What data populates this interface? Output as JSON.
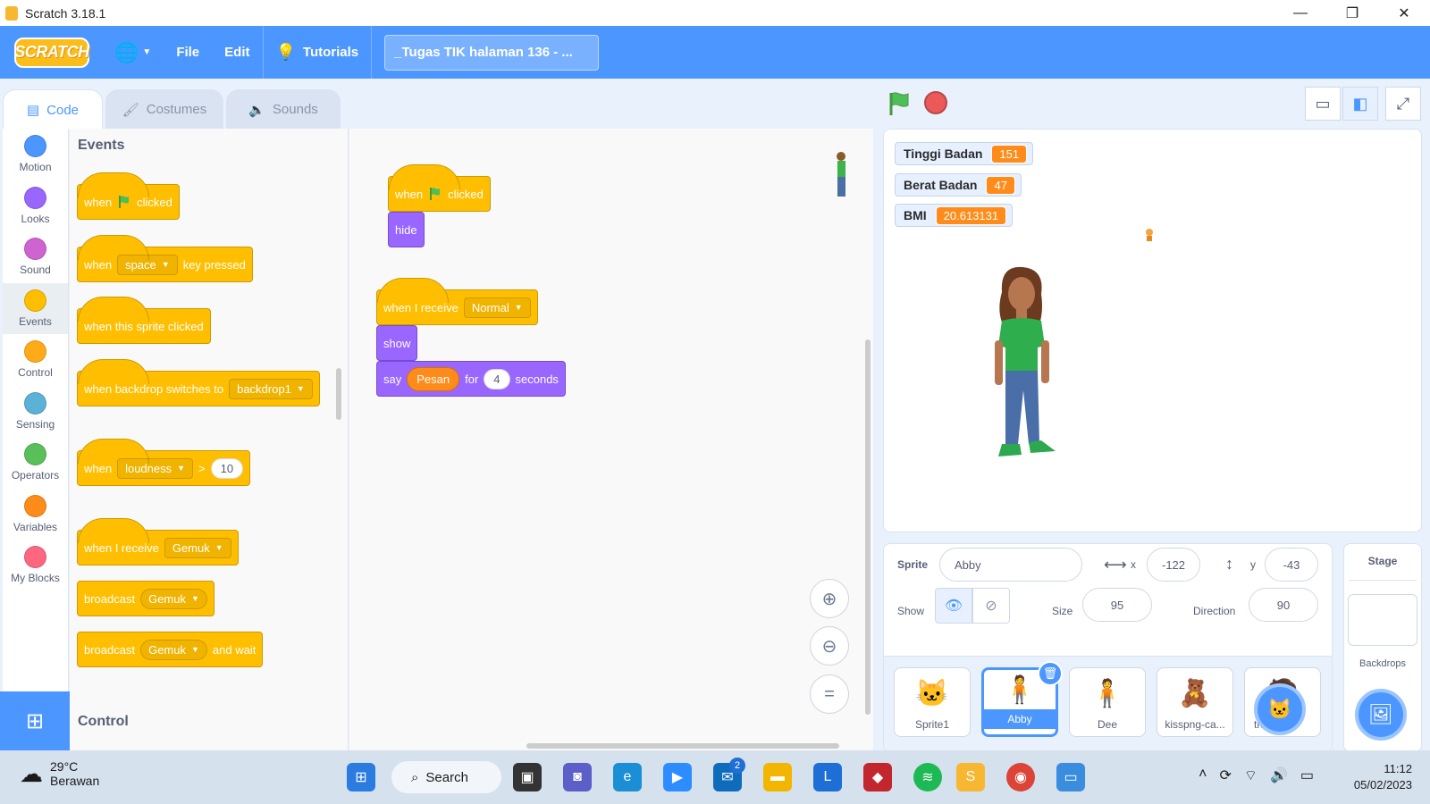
{
  "window": {
    "title": "Scratch 3.18.1"
  },
  "menubar": {
    "logo": "SCRATCH",
    "file": "File",
    "edit": "Edit",
    "tutorials": "Tutorials",
    "project_title": "_Tugas TIK halaman 136 - ..."
  },
  "tabs": {
    "code": "Code",
    "costumes": "Costumes",
    "sounds": "Sounds"
  },
  "categories": [
    {
      "label": "Motion",
      "color": "#4c97ff"
    },
    {
      "label": "Looks",
      "color": "#9966ff"
    },
    {
      "label": "Sound",
      "color": "#cf63cf"
    },
    {
      "label": "Events",
      "color": "#ffbf00"
    },
    {
      "label": "Control",
      "color": "#ffab19"
    },
    {
      "label": "Sensing",
      "color": "#5cb1d6"
    },
    {
      "label": "Operators",
      "color": "#59c059"
    },
    {
      "label": "Variables",
      "color": "#ff8c1a"
    },
    {
      "label": "My Blocks",
      "color": "#ff6680"
    }
  ],
  "palette": {
    "heading_events": "Events",
    "heading_control": "Control",
    "when_flag": {
      "a": "when",
      "b": "clicked"
    },
    "when_key": {
      "a": "when",
      "key": "space",
      "b": "key pressed"
    },
    "when_sprite_clicked": "when this sprite clicked",
    "when_backdrop": {
      "a": "when backdrop switches to",
      "value": "backdrop1"
    },
    "when_greater": {
      "a": "when",
      "value": "loudness",
      "op": ">",
      "num": "10"
    },
    "when_receive": {
      "a": "when I receive",
      "value": "Gemuk"
    },
    "broadcast": {
      "a": "broadcast",
      "value": "Gemuk"
    },
    "broadcast_wait": {
      "a": "broadcast",
      "value": "Gemuk",
      "b": "and wait"
    }
  },
  "workspace": {
    "script1": {
      "hat_a": "when",
      "hat_b": "clicked",
      "hide": "hide"
    },
    "script2": {
      "hat": "when I receive",
      "message": "Normal",
      "show": "show",
      "say": "say",
      "say_value": "Pesan",
      "for": "for",
      "seconds_value": "4",
      "seconds": "seconds"
    }
  },
  "stage": {
    "monitors": [
      {
        "label": "Tinggi Badan",
        "value": "151"
      },
      {
        "label": "Berat Badan",
        "value": "47"
      },
      {
        "label": "BMI",
        "value": "20.613131"
      }
    ]
  },
  "sprite_info": {
    "sprite_label": "Sprite",
    "sprite_name": "Abby",
    "x_label": "x",
    "x_value": "-122",
    "y_label": "y",
    "y_value": "-43",
    "show_label": "Show",
    "size_label": "Size",
    "size_value": "95",
    "direction_label": "Direction",
    "direction_value": "90"
  },
  "sprites": [
    {
      "name": "Sprite1",
      "icon": "cat-icon"
    },
    {
      "name": "Abby",
      "icon": "girl-icon",
      "selected": true
    },
    {
      "name": "Dee",
      "icon": "person-icon"
    },
    {
      "name": "kisspng-ca...",
      "icon": "character-icon"
    },
    {
      "name": "th-",
      "icon": "character-icon"
    }
  ],
  "stage_target": {
    "title": "Stage",
    "backdrops": "Backdrops"
  },
  "taskbar": {
    "temperature": "29°C",
    "weather": "Berawan",
    "search": "Search",
    "mail_badge": "2",
    "time": "11:12",
    "date": "05/02/2023"
  }
}
